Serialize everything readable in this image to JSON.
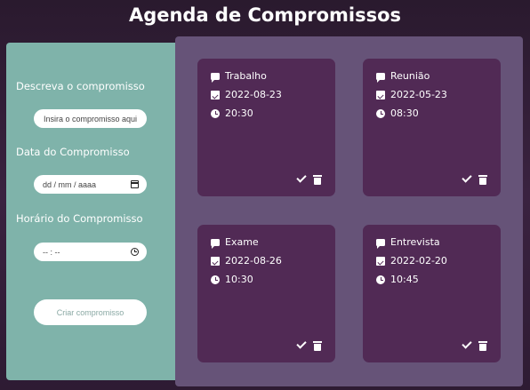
{
  "app": {
    "title": "Agenda de Compromissos"
  },
  "form": {
    "description_label": "Descreva o compromisso",
    "description_placeholder": "Insira o compromisso aqui",
    "date_label": "Data do Compromisso",
    "date_placeholder": "dd / mm / aaaa",
    "time_label": "Horário do Compromisso",
    "time_placeholder": "-- : --",
    "submit_label": "Criar compromisso"
  },
  "icons": {
    "title": "chat-icon",
    "date": "calendar-check-icon",
    "time": "clock-icon",
    "done": "check-icon",
    "delete": "trash-icon"
  },
  "colors": {
    "form_panel": "#7fb3aa",
    "board_panel": "#665378",
    "card": "#512a55"
  },
  "cards": [
    {
      "title": "Trabalho",
      "date": "2022-08-23",
      "time": "20:30"
    },
    {
      "title": "Reunião",
      "date": "2022-05-23",
      "time": "08:30"
    },
    {
      "title": "Exame",
      "date": "2022-08-26",
      "time": "10:30"
    },
    {
      "title": "Entrevista",
      "date": "2022-02-20",
      "time": "10:45"
    }
  ]
}
